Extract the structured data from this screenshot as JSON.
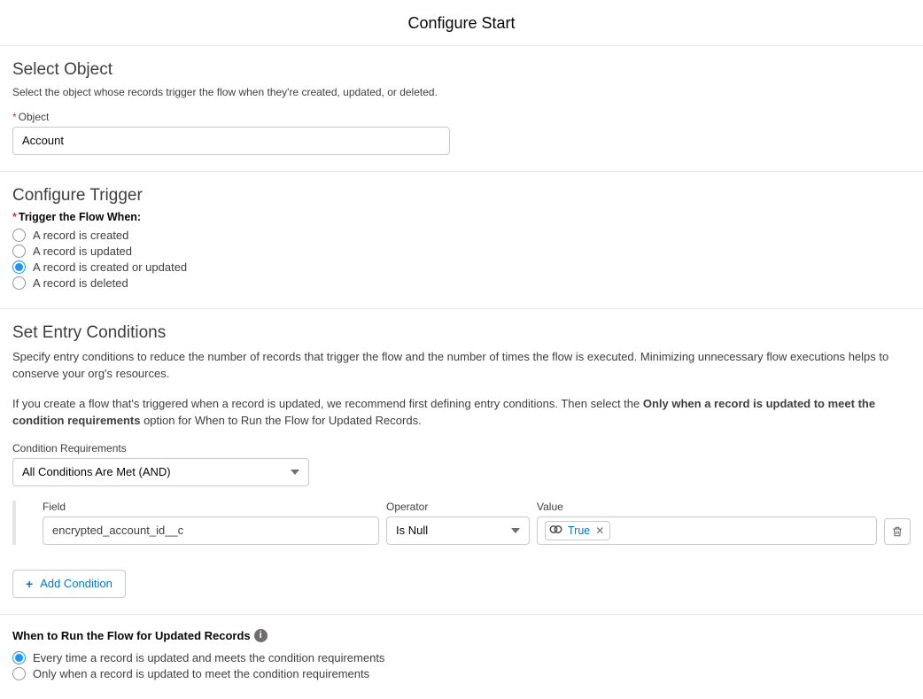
{
  "header": {
    "title": "Configure Start"
  },
  "select_object": {
    "heading": "Select Object",
    "description": "Select the object whose records trigger the flow when they're created, updated, or deleted.",
    "object_label": "Object",
    "object_value": "Account"
  },
  "configure_trigger": {
    "heading": "Configure Trigger",
    "label": "Trigger the Flow When:",
    "options": [
      {
        "label": "A record is created",
        "selected": false
      },
      {
        "label": "A record is updated",
        "selected": false
      },
      {
        "label": "A record is created or updated",
        "selected": true
      },
      {
        "label": "A record is deleted",
        "selected": false
      }
    ]
  },
  "entry_conditions": {
    "heading": "Set Entry Conditions",
    "desc1": "Specify entry conditions to reduce the number of records that trigger the flow and the number of times the flow is executed. Minimizing unnecessary flow executions helps to conserve your org's resources.",
    "desc2_part1": "If you create a flow that's triggered when a record is updated, we recommend first defining entry conditions. Then select the ",
    "desc2_bold": "Only when a record is updated to meet the condition requirements",
    "desc2_part2": " option for When to Run the Flow for Updated Records.",
    "condition_requirements_label": "Condition Requirements",
    "condition_requirements_value": "All Conditions Are Met (AND)",
    "row": {
      "field_label": "Field",
      "field_value": "encrypted_account_id__c",
      "operator_label": "Operator",
      "operator_value": "Is Null",
      "value_label": "Value",
      "value_pill": "True"
    },
    "add_condition_label": "Add Condition"
  },
  "when_run": {
    "label": "When to Run the Flow for Updated Records",
    "options": [
      {
        "label": "Every time a record is updated and meets the condition requirements",
        "selected": true
      },
      {
        "label": "Only when a record is updated to meet the condition requirements",
        "selected": false
      }
    ]
  }
}
